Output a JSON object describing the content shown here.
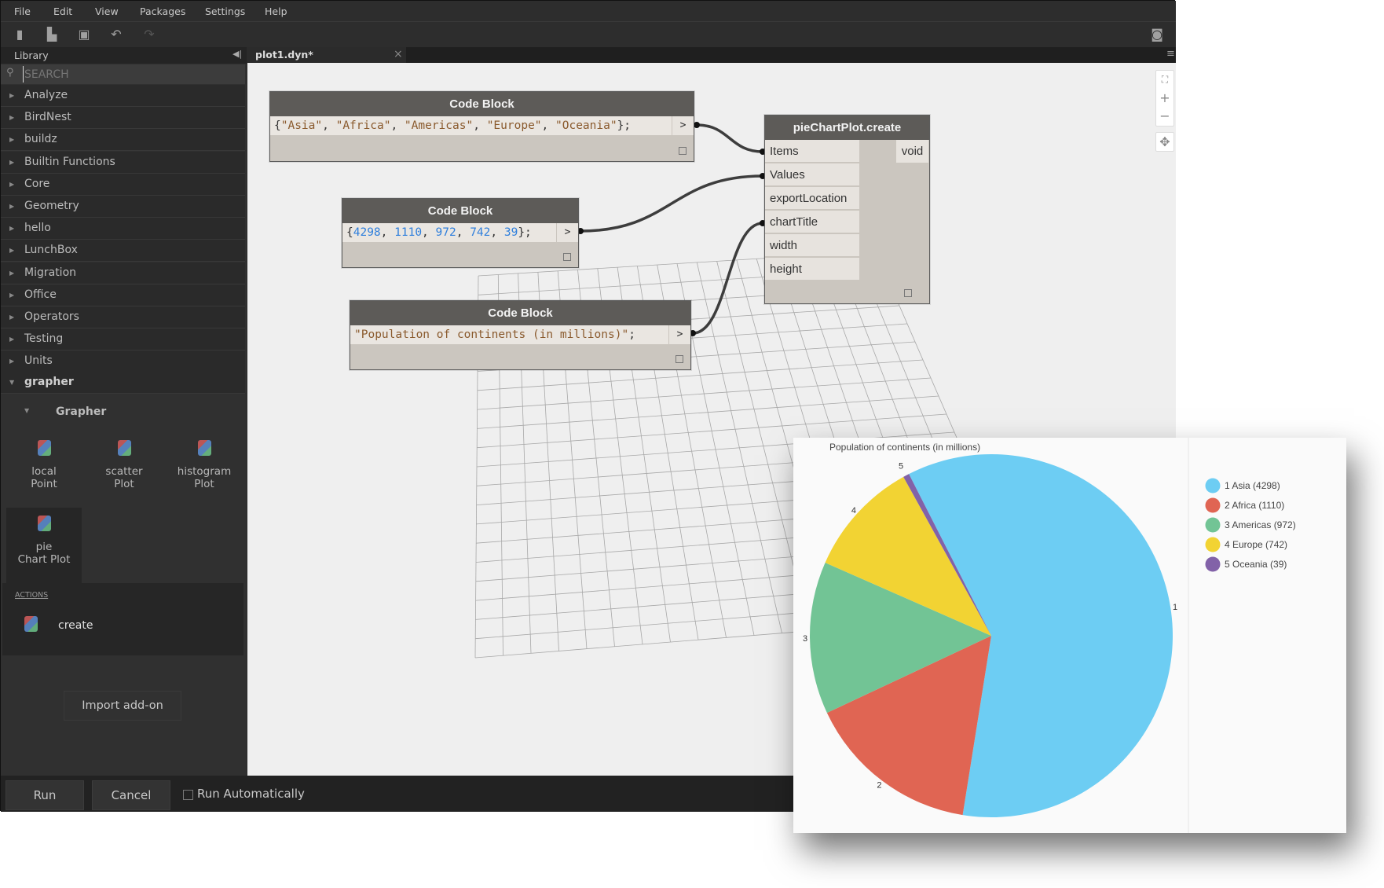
{
  "menu": [
    "File",
    "Edit",
    "View",
    "Packages",
    "Settings",
    "Help"
  ],
  "toolbar": {
    "icons": [
      "new-file-icon",
      "open-folder-icon",
      "save-icon",
      "undo-icon",
      "redo-icon"
    ],
    "camera": "camera-icon"
  },
  "library": {
    "title": "Library",
    "search_placeholder": "SEARCH",
    "categories": [
      "Analyze",
      "BirdNest",
      "buildz",
      "Builtin Functions",
      "Core",
      "Geometry",
      "hello",
      "LunchBox",
      "Migration",
      "Office",
      "Operators",
      "Testing",
      "Units"
    ],
    "expanded": "grapher",
    "subcategory": "Grapher",
    "tiles": [
      {
        "line1": "local",
        "line2": "Point"
      },
      {
        "line1": "scatter",
        "line2": "Plot"
      },
      {
        "line1": "histogram",
        "line2": "Plot"
      },
      {
        "line1": "pie",
        "line2": "Chart Plot"
      }
    ],
    "actions_label": "ACTIONS",
    "action": "create",
    "import_label": "Import add-on"
  },
  "tab": {
    "title": "plot1.dyn*",
    "close": "×"
  },
  "nodes": {
    "cb1": {
      "title": "Code Block",
      "code": "{\"Asia\", \"Africa\", \"Americas\", \"Europe\", \"Oceania\"};"
    },
    "cb2": {
      "title": "Code Block",
      "code": "{4298, 1110, 972, 742, 39};"
    },
    "cb3": {
      "title": "Code Block",
      "code": "\"Population of continents (in millions)\";"
    },
    "pie": {
      "title": "pieChartPlot.create",
      "inputs": [
        "Items",
        "Values",
        "exportLocation",
        "chartTitle",
        "width",
        "height"
      ],
      "output": "void"
    },
    "output_arrow": ">"
  },
  "bottom": {
    "run": "Run",
    "cancel": "Cancel",
    "run_auto": "Run Automatically",
    "run_auto_checked": false
  },
  "chart_data": {
    "type": "pie",
    "title": "Population of continents (in millions)",
    "categories": [
      "Asia",
      "Africa",
      "Americas",
      "Europe",
      "Oceania"
    ],
    "values": [
      4298,
      1110,
      972,
      742,
      39
    ],
    "slice_labels": [
      "1",
      "2",
      "3",
      "4",
      "5"
    ],
    "legend": [
      "1 Asia (4298)",
      "2 Africa (1110)",
      "3 Americas (972)",
      "4 Europe (742)",
      "5 Oceania (39)"
    ],
    "legend_placement": "right",
    "colors": [
      "#6dcdf3",
      "#e06553",
      "#72c495",
      "#f2d333",
      "#8262a8"
    ]
  }
}
